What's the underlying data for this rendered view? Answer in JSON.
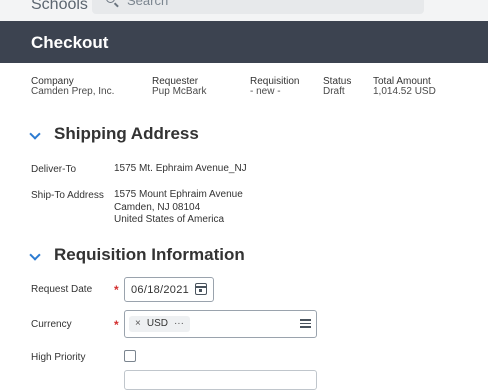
{
  "topbar": {
    "school": "Schools",
    "search_placeholder": "Search"
  },
  "page": {
    "title": "Checkout"
  },
  "meta": [
    {
      "label": "Company",
      "value": "Camden Prep, Inc."
    },
    {
      "label": "Requester",
      "value": "Pup McBark"
    },
    {
      "label": "Requisition",
      "value": "- new -"
    },
    {
      "label": "Status",
      "value": "Draft"
    },
    {
      "label": "Total Amount",
      "value": "1,014.52 USD"
    }
  ],
  "shipping": {
    "title": "Shipping Address",
    "deliver_to_label": "Deliver-To",
    "deliver_to_value": "1575 Mt. Ephraim Avenue_NJ",
    "ship_to_label": "Ship-To Address",
    "ship_to_lines": [
      "1575 Mount Ephraim Avenue",
      "Camden, NJ 08104",
      "United States of America"
    ]
  },
  "requisition": {
    "title": "Requisition Information",
    "request_date_label": "Request Date",
    "request_date_value": "06/18/2021",
    "currency_label": "Currency",
    "currency_value": "USD",
    "currency_remove": "×",
    "currency_more": "···",
    "high_priority_label": "High Priority",
    "required_marker": "*"
  },
  "icons": [
    "search-icon",
    "chevron-down-icon",
    "calendar-icon",
    "list-icon"
  ],
  "colors": {
    "header_bg": "#3c4350",
    "accent": "#2c7bd1",
    "required": "#d32f2f"
  }
}
